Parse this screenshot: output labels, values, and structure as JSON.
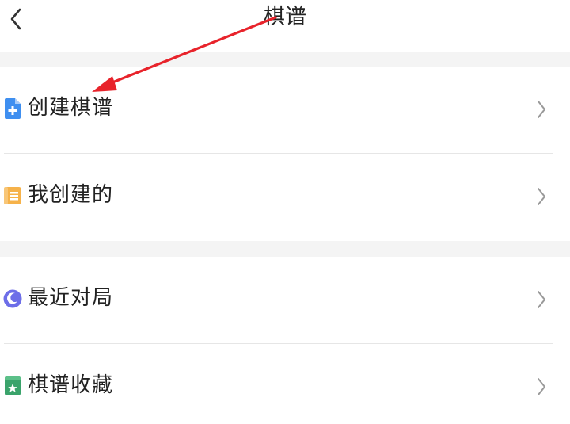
{
  "header": {
    "title": "棋谱"
  },
  "menu": {
    "group1": [
      {
        "label": "创建棋谱",
        "icon": "new-document-plus-icon",
        "icon_color": "#3f8ff0"
      },
      {
        "label": "我创建的",
        "icon": "folder-icon",
        "icon_color": "#f6b24a"
      }
    ],
    "group2": [
      {
        "label": "最近对局",
        "icon": "clock-moon-icon",
        "icon_color": "#6d6ee8"
      },
      {
        "label": "棋谱收藏",
        "icon": "bookmark-star-icon",
        "icon_color": "#3aa36b"
      }
    ]
  },
  "annotation": {
    "arrow_color": "#e8232b"
  }
}
